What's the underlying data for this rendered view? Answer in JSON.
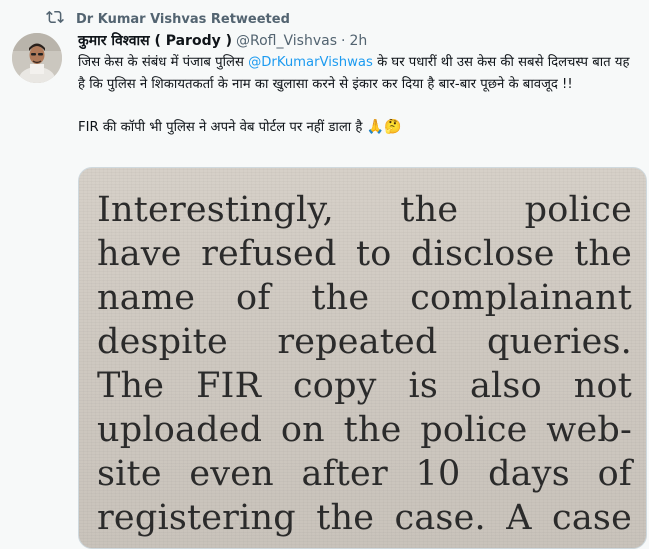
{
  "retweet": {
    "label": "Dr Kumar Vishvas Retweeted"
  },
  "author": {
    "name": "कुमार विश्वास ( Parody )",
    "handle": "@Rofl_Vishvas",
    "dot": "·",
    "time": "2h"
  },
  "tweet": {
    "line1_pre": "जिस केस के संबंध में पंजाब पुलिस ",
    "mention": "@DrKumarVishwas",
    "line1_post": " के घर पधारीं थी उस केस की सबसे दिलचस्प बात यह है कि पुलिस ने शिकायतकर्ता के नाम का खुलासा करने से इंकार कर दिया है बार-बार पूछने के बावजूद !!",
    "line2": "FIR की कॉपी भी पुलिस ने अपने वेब पोर्टल पर नहीं डाला है",
    "emojis": "🙏🤔"
  },
  "media": {
    "lines": [
      "Interestingly, the police",
      "have refused to disclose the",
      "name of the complainant",
      "despite repeated queries.",
      "The FIR copy is also not",
      "uploaded on the police web-",
      "site even after 10 days of",
      "registering the case. A case"
    ]
  },
  "colors": {
    "accent": "#1d9bf0",
    "secondary": "#536471",
    "background": "#f7f9f9"
  }
}
